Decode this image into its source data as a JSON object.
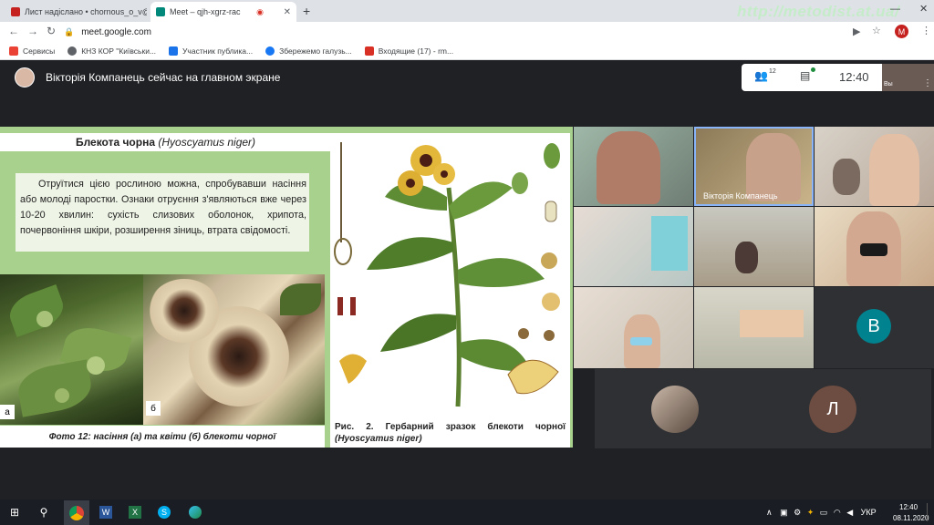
{
  "browser": {
    "tabs": [
      {
        "title": "Лист надіслано • chornous_o_v@",
        "favicon_color": "#c5221f"
      },
      {
        "title": "Meet – qjh-xgrz-rac",
        "favicon_color": "#00897b"
      }
    ],
    "watermark": "http://metodist.at.ua/",
    "url": "meet.google.com",
    "profile_initial": "M",
    "bookmarks": [
      {
        "label": "Сервисы",
        "color": "#ea4335"
      },
      {
        "label": "КНЗ КОР \"Київськи...",
        "color": "#5f6368"
      },
      {
        "label": "Участник публика...",
        "color": "#1a73e8"
      },
      {
        "label": "Збережемо галузь...",
        "color": "#1877f2"
      },
      {
        "label": "Входящие (17) - rm...",
        "color": "#d93025"
      }
    ]
  },
  "meet": {
    "presenter_text": "Вікторія Компанець сейчас на главном экране",
    "people_count": "12",
    "time": "12:40",
    "self_label": "Вы"
  },
  "slide": {
    "title_main": "Блекота чорна",
    "title_latin": "(Hyoscyamus niger)",
    "body": "Отруїтися цією рослиною можна, спробувавши насіння або молоді паростки. Ознаки отруєння з'являються вже через 10-20 хвилин: сухість слизових оболонок, хрипота, почервоніння шкіри, розширення зіниць, втрата свідомості.",
    "photo_a_label": "а",
    "photo_b_label": "б",
    "photo_caption": "Фото 12: насіння (а) та квіти (б) блекоти чорної",
    "herb_caption": "Рис. 2. Гербарний зразок блекоти чорної",
    "herb_caption_latin": "(Hyoscyamus niger)"
  },
  "participants": {
    "host_name": "Вікторія Компанець",
    "avatar_v": "В",
    "avatar_l": "Л"
  },
  "taskbar": {
    "lang": "УКР",
    "time": "12:40",
    "date": "08.11.2020"
  }
}
